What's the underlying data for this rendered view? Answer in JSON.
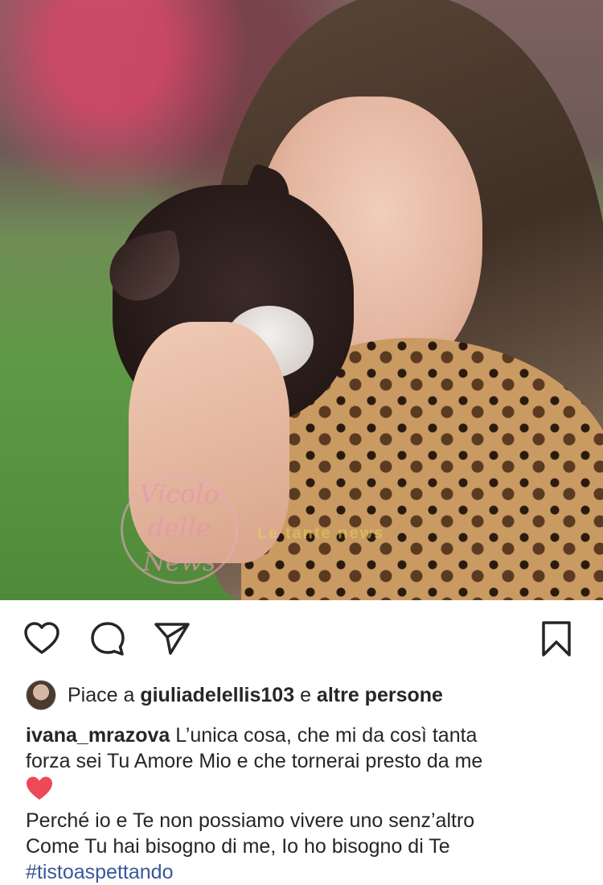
{
  "post": {
    "photo_alt_icon": "photo",
    "watermark_text": "Vicolo delle News",
    "watermark_text_2": "Le tante news",
    "actions": {
      "like_icon": "heart-outline-icon",
      "comment_icon": "comment-bubble-icon",
      "share_icon": "paper-plane-icon",
      "save_icon": "bookmark-icon"
    },
    "likes": {
      "prefix": "Piace a",
      "user": "giuliadelellis103",
      "connector": "e",
      "others": "altre persone"
    },
    "caption": {
      "username": "ivana_mrazova",
      "line1": "L’unica cosa, che mi da così tanta",
      "line2": "forza sei Tu Amore Mio e che tornerai presto da me",
      "emoji": "❤️",
      "line3": "Perché io e Te non possiamo vivere uno senz’altro",
      "line4": "Come Tu hai bisogno di me, Io ho bisogno di Te",
      "hashtag": "#tistoaspettando"
    }
  },
  "colors": {
    "text": "#262626",
    "hashtag": "#385898",
    "heart_red": "#ed4956"
  }
}
